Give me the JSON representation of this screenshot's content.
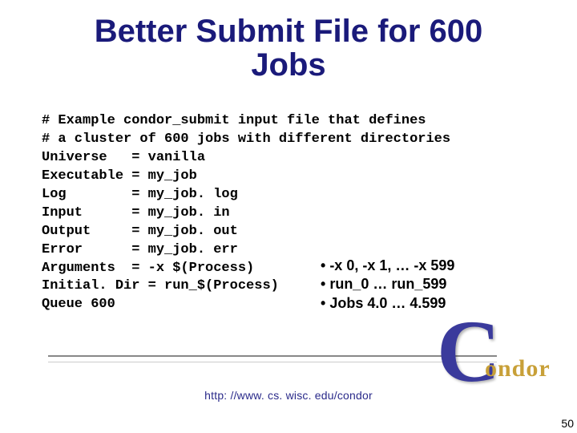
{
  "title_line1": "Better Submit File for 600",
  "title_line2": "Jobs",
  "code": {
    "l1": "# Example condor_submit input file that defines",
    "l2": "# a cluster of 600 jobs with different directories",
    "l3": "Universe   = vanilla",
    "l4": "Executable = my_job",
    "l5": "Log        = my_job. log",
    "l6": "Input      = my_job. in",
    "l7": "Output     = my_job. out",
    "l8": "Error      = my_job. err",
    "l9": "Arguments  = -x $(Process)",
    "l10": "Initial. Dir = run_$(Process)",
    "l11": "Queue 600"
  },
  "bullets": {
    "b1": "-x 0, -x 1, … -x 599",
    "b2": "run_0 … run_599",
    "b3": "Jobs 4.0 … 4.599"
  },
  "logo": {
    "c": "C",
    "rest": "ondor"
  },
  "footer": "http: //www. cs. wisc. edu/condor",
  "page": "50"
}
